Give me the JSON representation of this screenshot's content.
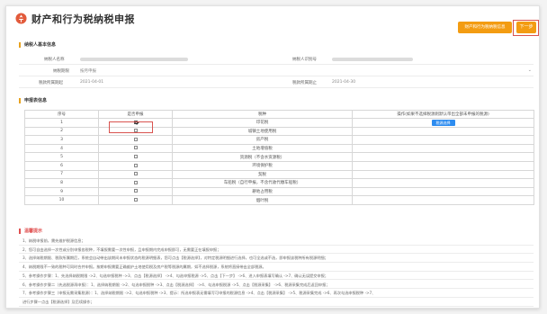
{
  "header": {
    "title": "财产和行为税纳税申报",
    "info_button": "财产和行为税纳税信息",
    "next_button": "下一步"
  },
  "basic_info": {
    "section_title": "纳税人基本信息",
    "taxpayer_name_label": "纳税人名称",
    "taxpayer_id_label": "纳税人识别号",
    "period_type_label": "纳税期限",
    "period_type_value": "按月申报",
    "period_start_label": "税款所属期起",
    "period_start_value": "2021-04-01",
    "period_end_label": "税款所属期止",
    "period_end_value": "2021-04-30"
  },
  "declare_info": {
    "section_title": "申报表信息",
    "columns": {
      "index": "序号",
      "declare": "是否申报",
      "tax": "税种",
      "action": "操作(如果不选择税源则默认带出全部未申报的税源)"
    },
    "select_button": "税源选择",
    "rows": [
      {
        "index": "1",
        "tax": "印花税",
        "checked": true
      },
      {
        "index": "2",
        "tax": "城镇土地使用税",
        "checked": false
      },
      {
        "index": "3",
        "tax": "房产税",
        "checked": false
      },
      {
        "index": "4",
        "tax": "土地增值税",
        "checked": false
      },
      {
        "index": "5",
        "tax": "资源税（不含水资源税）",
        "checked": false
      },
      {
        "index": "6",
        "tax": "环境保护税",
        "checked": false
      },
      {
        "index": "7",
        "tax": "契税",
        "checked": false
      },
      {
        "index": "8",
        "tax": "车船税（自行申报，不含代收代缴车船税）",
        "checked": false
      },
      {
        "index": "9",
        "tax": "耕地占用税",
        "checked": false
      },
      {
        "index": "10",
        "tax": "烟叶税",
        "checked": false
      }
    ]
  },
  "tips": {
    "section_title": "温馨提示",
    "items": [
      "1、纳税申报前，需先维护税源信息；",
      "2、您可自由选择一次性或分别申报各税种，不填报需要一次性申报，且申报期内完成申报即可，无需要正在填报申报；",
      "3、选择纳税期限、税款所属期后，系统会自动带出该期间未申报状态的税源明细表，您可点击【税源选择】，对特定税源明细进行选择，也可全选或不选，即申报该税种所有税源明细；",
      "4、纳税期限不一致的税种可同时合并申报。按期申报需要正确维护土地使用税及房产税等税源的属期，如不选择税源，系统将直接带出全部税源。",
      "5、参考操作步骤：1、先选择纳税期限 ->2、勾选申报税种 ->3、点击【税源选择】 ->4、勾选申报税源 ->5、点击【下一步】 ->6、进入申报表填写确认 ->7、确认无误提交申报；",
      "6、参考操作步骤二（先选税源再申报）：1、选择纳税期限 ->2、勾选申报税种 ->3、点击【税源选择】 ->4、勾选申报税源 ->5、点击【税源采集】 ->6、税源采集完成后返回申报；",
      "7、参考操作步骤三（申报无需采集税源）：1、选择纳税期限 ->2、勾选申报税种 ->3、提示：所选申报表无需填写可申报的税源信息 ->4、点击【税源采集】 ->5、税源采集完成 ->6、再次勾选申报税种 ->7、",
      "进行步骤一点击【税源选择】及后续操作；"
    ]
  }
}
